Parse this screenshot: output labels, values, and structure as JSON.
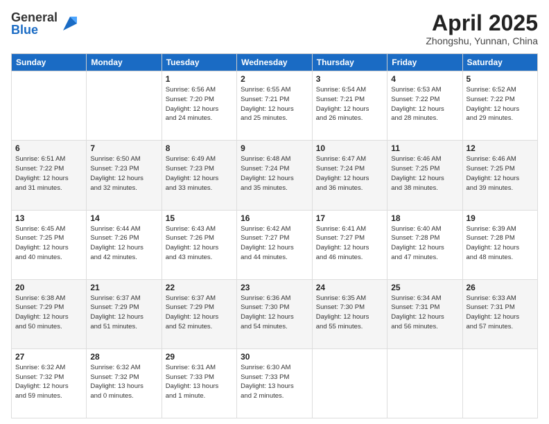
{
  "logo": {
    "general": "General",
    "blue": "Blue"
  },
  "header": {
    "month": "April 2025",
    "location": "Zhongshu, Yunnan, China"
  },
  "days_of_week": [
    "Sunday",
    "Monday",
    "Tuesday",
    "Wednesday",
    "Thursday",
    "Friday",
    "Saturday"
  ],
  "weeks": [
    [
      {
        "day": "",
        "info": ""
      },
      {
        "day": "",
        "info": ""
      },
      {
        "day": "1",
        "info": "Sunrise: 6:56 AM\nSunset: 7:20 PM\nDaylight: 12 hours\nand 24 minutes."
      },
      {
        "day": "2",
        "info": "Sunrise: 6:55 AM\nSunset: 7:21 PM\nDaylight: 12 hours\nand 25 minutes."
      },
      {
        "day": "3",
        "info": "Sunrise: 6:54 AM\nSunset: 7:21 PM\nDaylight: 12 hours\nand 26 minutes."
      },
      {
        "day": "4",
        "info": "Sunrise: 6:53 AM\nSunset: 7:22 PM\nDaylight: 12 hours\nand 28 minutes."
      },
      {
        "day": "5",
        "info": "Sunrise: 6:52 AM\nSunset: 7:22 PM\nDaylight: 12 hours\nand 29 minutes."
      }
    ],
    [
      {
        "day": "6",
        "info": "Sunrise: 6:51 AM\nSunset: 7:22 PM\nDaylight: 12 hours\nand 31 minutes."
      },
      {
        "day": "7",
        "info": "Sunrise: 6:50 AM\nSunset: 7:23 PM\nDaylight: 12 hours\nand 32 minutes."
      },
      {
        "day": "8",
        "info": "Sunrise: 6:49 AM\nSunset: 7:23 PM\nDaylight: 12 hours\nand 33 minutes."
      },
      {
        "day": "9",
        "info": "Sunrise: 6:48 AM\nSunset: 7:24 PM\nDaylight: 12 hours\nand 35 minutes."
      },
      {
        "day": "10",
        "info": "Sunrise: 6:47 AM\nSunset: 7:24 PM\nDaylight: 12 hours\nand 36 minutes."
      },
      {
        "day": "11",
        "info": "Sunrise: 6:46 AM\nSunset: 7:25 PM\nDaylight: 12 hours\nand 38 minutes."
      },
      {
        "day": "12",
        "info": "Sunrise: 6:46 AM\nSunset: 7:25 PM\nDaylight: 12 hours\nand 39 minutes."
      }
    ],
    [
      {
        "day": "13",
        "info": "Sunrise: 6:45 AM\nSunset: 7:25 PM\nDaylight: 12 hours\nand 40 minutes."
      },
      {
        "day": "14",
        "info": "Sunrise: 6:44 AM\nSunset: 7:26 PM\nDaylight: 12 hours\nand 42 minutes."
      },
      {
        "day": "15",
        "info": "Sunrise: 6:43 AM\nSunset: 7:26 PM\nDaylight: 12 hours\nand 43 minutes."
      },
      {
        "day": "16",
        "info": "Sunrise: 6:42 AM\nSunset: 7:27 PM\nDaylight: 12 hours\nand 44 minutes."
      },
      {
        "day": "17",
        "info": "Sunrise: 6:41 AM\nSunset: 7:27 PM\nDaylight: 12 hours\nand 46 minutes."
      },
      {
        "day": "18",
        "info": "Sunrise: 6:40 AM\nSunset: 7:28 PM\nDaylight: 12 hours\nand 47 minutes."
      },
      {
        "day": "19",
        "info": "Sunrise: 6:39 AM\nSunset: 7:28 PM\nDaylight: 12 hours\nand 48 minutes."
      }
    ],
    [
      {
        "day": "20",
        "info": "Sunrise: 6:38 AM\nSunset: 7:29 PM\nDaylight: 12 hours\nand 50 minutes."
      },
      {
        "day": "21",
        "info": "Sunrise: 6:37 AM\nSunset: 7:29 PM\nDaylight: 12 hours\nand 51 minutes."
      },
      {
        "day": "22",
        "info": "Sunrise: 6:37 AM\nSunset: 7:29 PM\nDaylight: 12 hours\nand 52 minutes."
      },
      {
        "day": "23",
        "info": "Sunrise: 6:36 AM\nSunset: 7:30 PM\nDaylight: 12 hours\nand 54 minutes."
      },
      {
        "day": "24",
        "info": "Sunrise: 6:35 AM\nSunset: 7:30 PM\nDaylight: 12 hours\nand 55 minutes."
      },
      {
        "day": "25",
        "info": "Sunrise: 6:34 AM\nSunset: 7:31 PM\nDaylight: 12 hours\nand 56 minutes."
      },
      {
        "day": "26",
        "info": "Sunrise: 6:33 AM\nSunset: 7:31 PM\nDaylight: 12 hours\nand 57 minutes."
      }
    ],
    [
      {
        "day": "27",
        "info": "Sunrise: 6:32 AM\nSunset: 7:32 PM\nDaylight: 12 hours\nand 59 minutes."
      },
      {
        "day": "28",
        "info": "Sunrise: 6:32 AM\nSunset: 7:32 PM\nDaylight: 13 hours\nand 0 minutes."
      },
      {
        "day": "29",
        "info": "Sunrise: 6:31 AM\nSunset: 7:33 PM\nDaylight: 13 hours\nand 1 minute."
      },
      {
        "day": "30",
        "info": "Sunrise: 6:30 AM\nSunset: 7:33 PM\nDaylight: 13 hours\nand 2 minutes."
      },
      {
        "day": "",
        "info": ""
      },
      {
        "day": "",
        "info": ""
      },
      {
        "day": "",
        "info": ""
      }
    ]
  ]
}
